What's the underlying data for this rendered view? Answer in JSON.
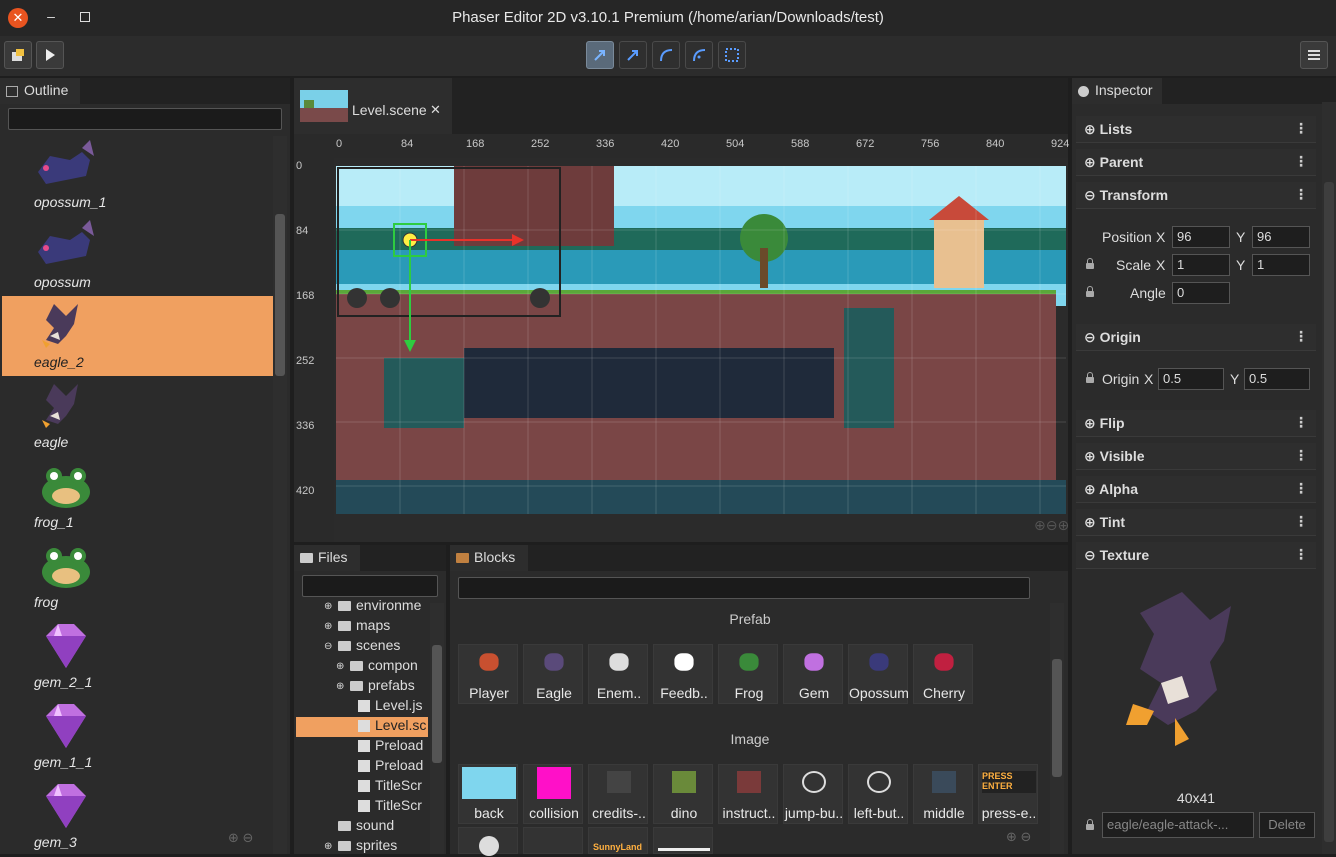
{
  "window": {
    "title": "Phaser Editor 2D v3.10.1 Premium (/home/arian/Downloads/test)"
  },
  "toolbar": {
    "tools": [
      "select-tool",
      "translate-tool",
      "scale-tool",
      "rotate-tool",
      "resize-tool"
    ],
    "active_tool": "select-tool"
  },
  "outline": {
    "tab": "Outline",
    "items": [
      {
        "label": "opossum_1",
        "icon": "opossum"
      },
      {
        "label": "opossum",
        "icon": "opossum"
      },
      {
        "label": "eagle_2",
        "icon": "eagle",
        "selected": true
      },
      {
        "label": "eagle",
        "icon": "eagle"
      },
      {
        "label": "frog_1",
        "icon": "frog"
      },
      {
        "label": "frog",
        "icon": "frog"
      },
      {
        "label": "gem_2_1",
        "icon": "gem"
      },
      {
        "label": "gem_1_1",
        "icon": "gem"
      },
      {
        "label": "gem_3",
        "icon": "gem"
      }
    ]
  },
  "scene": {
    "tab": "Level.scene",
    "ruler_x": [
      "0",
      "84",
      "168",
      "252",
      "336",
      "420",
      "504",
      "588",
      "672",
      "756",
      "840",
      "924"
    ],
    "ruler_y": [
      "0",
      "84",
      "168",
      "252",
      "336",
      "420"
    ]
  },
  "files": {
    "tab": "Files",
    "rows": [
      {
        "label": "environme",
        "kind": "folder",
        "expander": "+"
      },
      {
        "label": "maps",
        "kind": "folder",
        "expander": "+"
      },
      {
        "label": "scenes",
        "kind": "folder",
        "expander": "-"
      },
      {
        "label": "compon",
        "kind": "folder",
        "expander": "+"
      },
      {
        "label": "prefabs",
        "kind": "folder",
        "expander": "+"
      },
      {
        "label": "Level.js",
        "kind": "file"
      },
      {
        "label": "Level.sc",
        "kind": "file",
        "selected": true
      },
      {
        "label": "Preload",
        "kind": "file"
      },
      {
        "label": "Preload",
        "kind": "file"
      },
      {
        "label": "TitleScr",
        "kind": "file"
      },
      {
        "label": "TitleScr",
        "kind": "file"
      },
      {
        "label": "sound",
        "kind": "folder"
      },
      {
        "label": "sprites",
        "kind": "folder",
        "expander": "+"
      }
    ]
  },
  "blocks": {
    "tab": "Blocks",
    "sections": {
      "prefab": "Prefab",
      "image": "Image"
    },
    "prefabs": [
      "Player",
      "Eagle",
      "Enem..",
      "Feedb..",
      "Frog",
      "Gem",
      "Opossum",
      "Cherry"
    ],
    "images": [
      "back",
      "collision",
      "credits-..",
      "dino",
      "instruct..",
      "jump-bu..",
      "left-but..",
      "middle",
      "press-e.."
    ],
    "press_enter_text": "PRESS ENTER",
    "sunny_text": "SunnyLand"
  },
  "inspector": {
    "tab": "Inspector",
    "sections": [
      "Lists",
      "Parent",
      "Transform",
      "Origin",
      "Flip",
      "Visible",
      "Alpha",
      "Tint",
      "Texture"
    ],
    "transform": {
      "position_label": "Position",
      "x_label": "X",
      "y_label": "Y",
      "position_x": "96",
      "position_y": "96",
      "scale_label": "Scale",
      "scale_x": "1",
      "scale_y": "1",
      "angle_label": "Angle",
      "angle": "0"
    },
    "origin": {
      "label": "Origin",
      "x": "0.5",
      "y": "0.5"
    },
    "texture": {
      "size": "40x41",
      "key": "eagle/eagle-attack-...",
      "delete_label": "Delete"
    }
  }
}
